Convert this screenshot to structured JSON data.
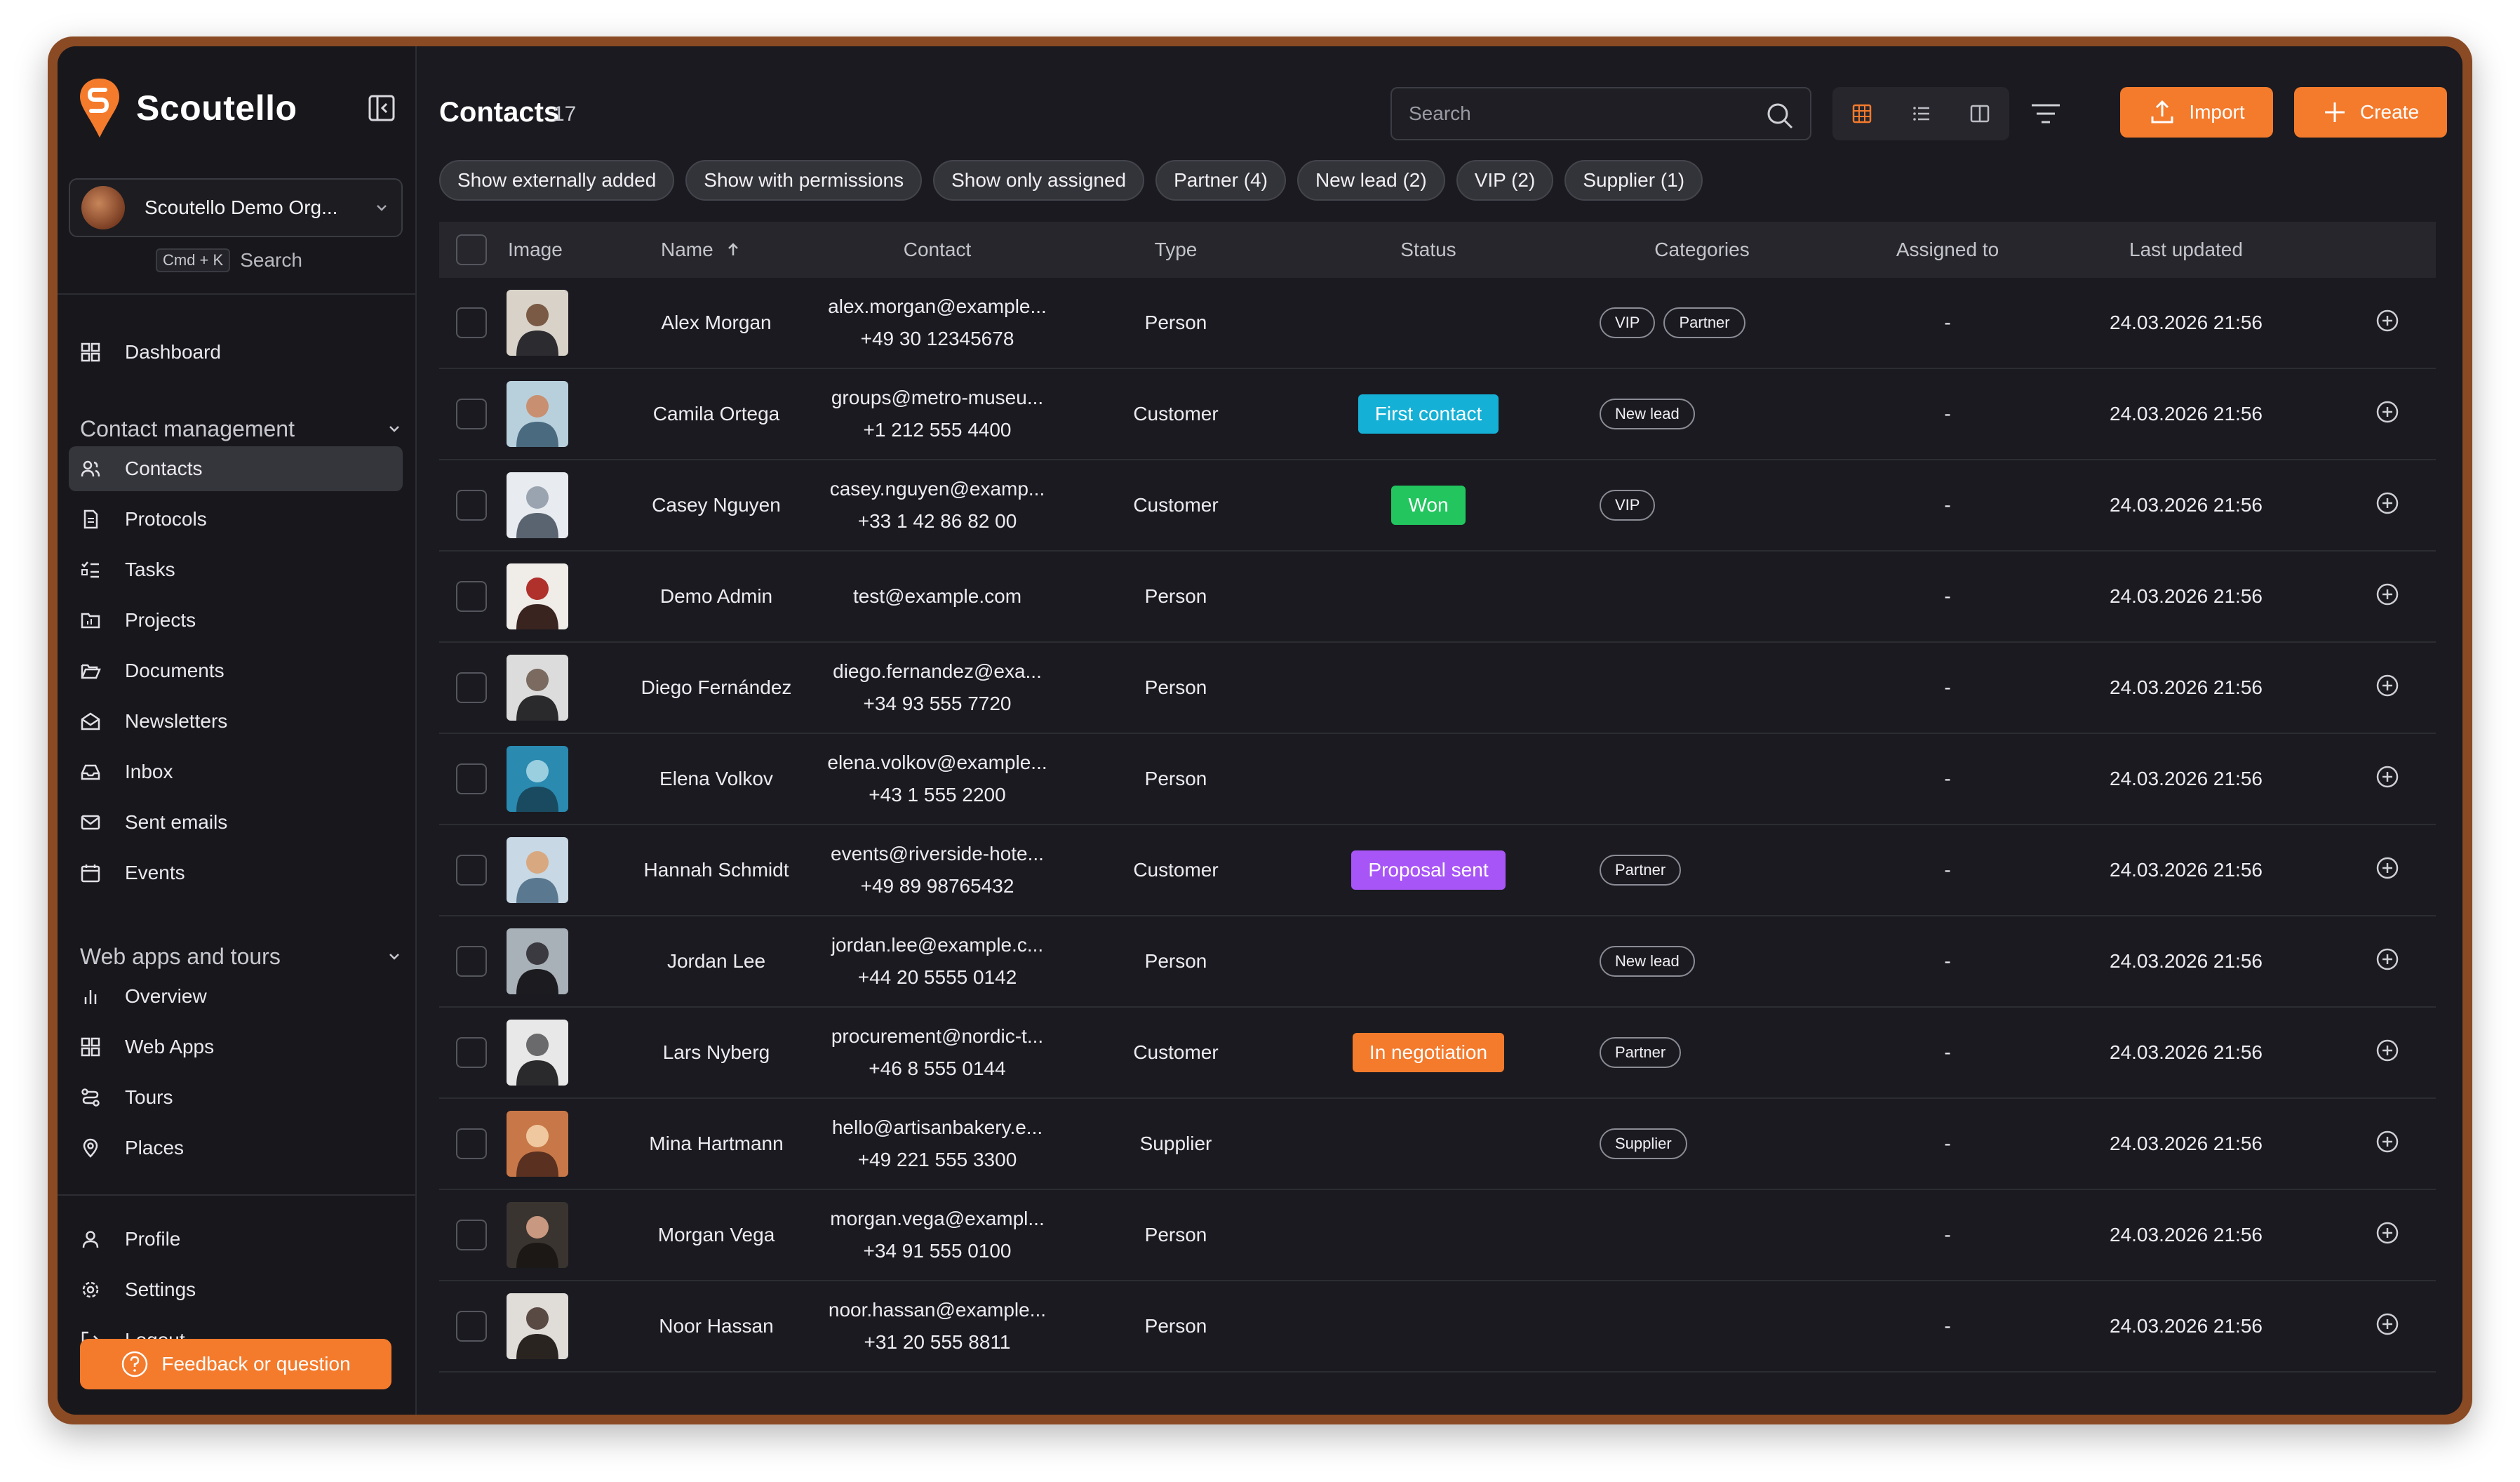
{
  "app": {
    "name": "Scoutello",
    "org_name": "Scoutello Demo Org...",
    "search_shortcut": "Cmd + K",
    "search_label": "Search"
  },
  "sidebar": {
    "dashboard": "Dashboard",
    "section1": "Contact management",
    "section1_items": [
      "Contacts",
      "Protocols",
      "Tasks",
      "Projects",
      "Documents",
      "Newsletters",
      "Inbox",
      "Sent emails",
      "Events"
    ],
    "section2": "Web apps and tours",
    "section2_items": [
      "Overview",
      "Web Apps",
      "Tours",
      "Places"
    ],
    "bottom_items": [
      "Profile",
      "Settings",
      "Logout"
    ],
    "feedback_label": "Feedback or question"
  },
  "header": {
    "title": "Contacts",
    "count": "17",
    "search_placeholder": "Search",
    "import_label": "Import",
    "create_label": "Create"
  },
  "filters": [
    "Show externally added",
    "Show with permissions",
    "Show only assigned",
    "Partner (4)",
    "New lead (2)",
    "VIP (2)",
    "Supplier (1)"
  ],
  "columns": {
    "image": "Image",
    "name": "Name",
    "contact": "Contact",
    "type": "Type",
    "status": "Status",
    "categories": "Categories",
    "assigned": "Assigned to",
    "updated": "Last updated"
  },
  "colors": {
    "accent": "#f47a2c",
    "status_first_contact": "#14b0d6",
    "status_won": "#22c55e",
    "status_proposal_sent": "#a855f7",
    "status_in_negotiation": "#f47a2c"
  },
  "rows": [
    {
      "name": "Alex Morgan",
      "email": "alex.morgan@example...",
      "phone": "+49 30 12345678",
      "type": "Person",
      "status": "",
      "categories": [
        "VIP",
        "Partner"
      ],
      "assigned": "-",
      "updated": "24.03.2026 21:56"
    },
    {
      "name": "Camila Ortega",
      "email": "groups@metro-museu...",
      "phone": "+1 212 555 4400",
      "type": "Customer",
      "status": "First contact",
      "categories": [
        "New lead"
      ],
      "assigned": "-",
      "updated": "24.03.2026 21:56"
    },
    {
      "name": "Casey Nguyen",
      "email": "casey.nguyen@examp...",
      "phone": "+33 1 42 86 82 00",
      "type": "Customer",
      "status": "Won",
      "categories": [
        "VIP"
      ],
      "assigned": "-",
      "updated": "24.03.2026 21:56"
    },
    {
      "name": "Demo Admin",
      "email": "test@example.com",
      "phone": "",
      "type": "Person",
      "status": "",
      "categories": [],
      "assigned": "-",
      "updated": "24.03.2026 21:56"
    },
    {
      "name": "Diego Fernández",
      "email": "diego.fernandez@exa...",
      "phone": "+34 93 555 7720",
      "type": "Person",
      "status": "",
      "categories": [],
      "assigned": "-",
      "updated": "24.03.2026 21:56"
    },
    {
      "name": "Elena Volkov",
      "email": "elena.volkov@example...",
      "phone": "+43 1 555 2200",
      "type": "Person",
      "status": "",
      "categories": [],
      "assigned": "-",
      "updated": "24.03.2026 21:56"
    },
    {
      "name": "Hannah Schmidt",
      "email": "events@riverside-hote...",
      "phone": "+49 89 98765432",
      "type": "Customer",
      "status": "Proposal sent",
      "categories": [
        "Partner"
      ],
      "assigned": "-",
      "updated": "24.03.2026 21:56"
    },
    {
      "name": "Jordan Lee",
      "email": "jordan.lee@example.c...",
      "phone": "+44 20 5555 0142",
      "type": "Person",
      "status": "",
      "categories": [
        "New lead"
      ],
      "assigned": "-",
      "updated": "24.03.2026 21:56"
    },
    {
      "name": "Lars Nyberg",
      "email": "procurement@nordic-t...",
      "phone": "+46 8 555 0144",
      "type": "Customer",
      "status": "In negotiation",
      "categories": [
        "Partner"
      ],
      "assigned": "-",
      "updated": "24.03.2026 21:56"
    },
    {
      "name": "Mina Hartmann",
      "email": "hello@artisanbakery.e...",
      "phone": "+49 221 555 3300",
      "type": "Supplier",
      "status": "",
      "categories": [
        "Supplier"
      ],
      "assigned": "-",
      "updated": "24.03.2026 21:56"
    },
    {
      "name": "Morgan Vega",
      "email": "morgan.vega@exampl...",
      "phone": "+34 91 555 0100",
      "type": "Person",
      "status": "",
      "categories": [],
      "assigned": "-",
      "updated": "24.03.2026 21:56"
    },
    {
      "name": "Noor Hassan",
      "email": "noor.hassan@example...",
      "phone": "+31 20 555 8811",
      "type": "Person",
      "status": "",
      "categories": [],
      "assigned": "-",
      "updated": "24.03.2026 21:56"
    }
  ]
}
